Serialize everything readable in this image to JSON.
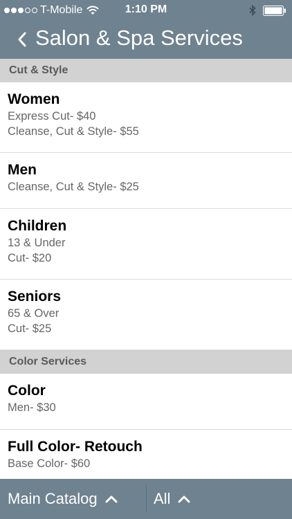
{
  "status_bar": {
    "signal_full": 3,
    "signal_empty": 2,
    "carrier": "T-Mobile",
    "time": "1:10 PM"
  },
  "nav": {
    "back_icon": "chevron-left-icon",
    "title": "Salon & Spa Services"
  },
  "sections": [
    {
      "header": "Cut & Style",
      "items": [
        {
          "title": "Women",
          "lines": [
            "Express Cut- $40",
            "Cleanse, Cut & Style- $55"
          ]
        },
        {
          "title": "Men",
          "lines": [
            "Cleanse, Cut & Style- $25"
          ]
        },
        {
          "title": "Children",
          "lines": [
            "13 & Under",
            "Cut- $20"
          ]
        },
        {
          "title": "Seniors",
          "lines": [
            "65 & Over",
            "Cut- $25"
          ]
        }
      ]
    },
    {
      "header": "Color Services",
      "items": [
        {
          "title": "Color",
          "lines": [
            "Men- $30"
          ]
        },
        {
          "title": "Full Color- Retouch",
          "lines": [
            "Base Color- $60"
          ]
        }
      ]
    }
  ],
  "toolbar": {
    "catalog_label": "Main Catalog",
    "all_label": "All",
    "chevron_icon": "chevron-up-icon"
  },
  "colors": {
    "bar_bg": "#6f8290",
    "section_bg": "#d2d2d2",
    "section_text": "#5a5a5a",
    "secondary_text": "#666666"
  }
}
